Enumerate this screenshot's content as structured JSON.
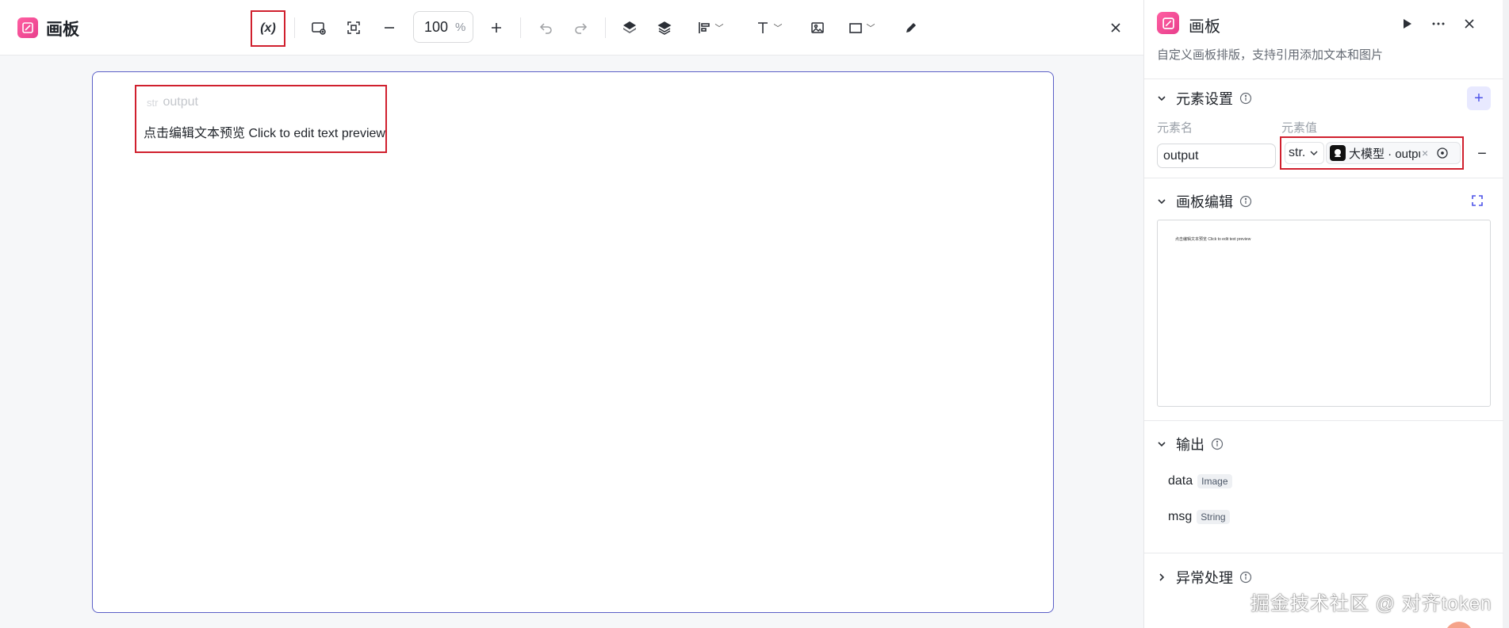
{
  "app": {
    "title": "画板"
  },
  "toolbar": {
    "variable_label": "(x)",
    "zoom_value": "100",
    "zoom_unit": "%",
    "icons": [
      "variable-icon",
      "add-image-frame-icon",
      "fit-screen-icon",
      "zoom-out-icon",
      "zoom-in-icon",
      "undo-icon",
      "redo-icon",
      "bring-forward-icon",
      "send-backward-icon",
      "align-icon",
      "text-icon",
      "image-icon",
      "rectangle-icon",
      "pen-icon",
      "close-icon"
    ]
  },
  "canvas": {
    "element_tag_type": "str",
    "element_tag_name": "output",
    "element_text": "点击编辑文本预览 Click to edit text preview",
    "frame_color": "#5b5fc7",
    "highlight_color": "#d0202e"
  },
  "panel": {
    "title": "画板",
    "description": "自定义画板排版，支持引用添加文本和图片",
    "element_settings": {
      "title": "元素设置",
      "col_name": "元素名",
      "col_value": "元素值",
      "rows": [
        {
          "name": "output",
          "type": "str.",
          "ref": "大模型 · output"
        }
      ],
      "add_label": "+",
      "remove_label": "−"
    },
    "canvas_edit": {
      "title": "画板编辑",
      "preview_text": "点击编辑文本预览 Click to edit text preview"
    },
    "output": {
      "title": "输出",
      "items": [
        {
          "name": "data",
          "type": "Image"
        },
        {
          "name": "msg",
          "type": "String"
        }
      ]
    },
    "exception": {
      "title": "异常处理"
    }
  },
  "watermark": "掘金技术社区 @ 对齐token",
  "colors": {
    "brand": "#e83e8c",
    "accent": "#4d53e8"
  }
}
